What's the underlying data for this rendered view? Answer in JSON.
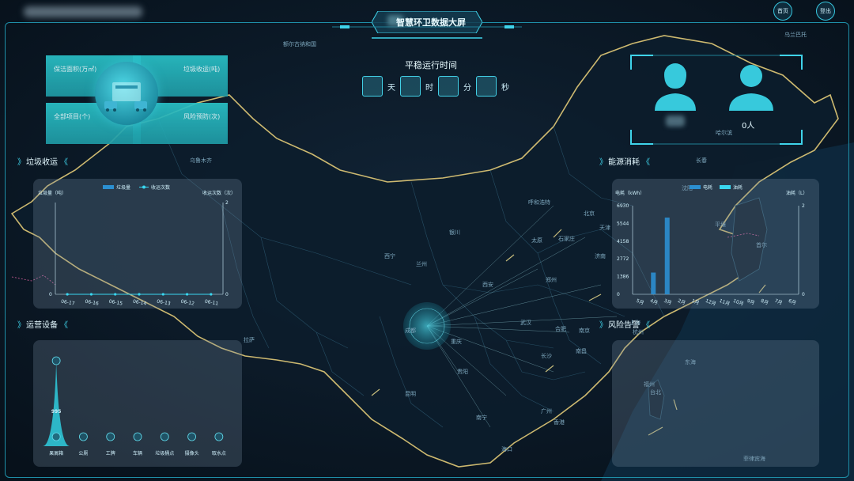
{
  "header": {
    "title": "智慧环卫数据大屏",
    "btn_home": "首页",
    "btn_logout": "登出"
  },
  "runtime": {
    "title": "平稳运行时间",
    "units": [
      "天",
      "时",
      "分",
      "秒"
    ]
  },
  "summary": {
    "clean_area_label": "保洁面积(万㎡)",
    "garbage_label": "垃圾收运(吨)",
    "projects_label": "全部项目(个)",
    "risk_label": "风险预防(次)"
  },
  "people": {
    "male_count": "0人"
  },
  "sections": {
    "garbage": "垃圾收运",
    "energy": "能源消耗",
    "equipment": "运营设备",
    "risk": "风险告警"
  },
  "map_labels": [
    "额尔古纳和国",
    "乌鲁木齐",
    "哈尔滨",
    "长春",
    "沈阳",
    "呼和浩特",
    "北京",
    "天津",
    "银川",
    "太原",
    "石家庄",
    "西宁",
    "兰州",
    "济南",
    "郑州",
    "西安",
    "拉萨",
    "成都",
    "重庆",
    "武汉",
    "合肥",
    "南京",
    "上海",
    "杭州",
    "长沙",
    "南昌",
    "福州",
    "贵阳",
    "昆明",
    "南宁",
    "广州",
    "香港",
    "台北",
    "海口",
    "东海",
    "菲律宾海",
    "首尔",
    "平壤",
    "乌兰巴托"
  ],
  "chart_data": [
    {
      "type": "bar",
      "title": "垃圾收运",
      "categories": [
        "06-17",
        "06-16",
        "06-15",
        "06-14",
        "06-13",
        "06-12",
        "06-11"
      ],
      "series": [
        {
          "name": "垃圾量",
          "values": [
            0,
            0,
            0,
            0,
            0,
            0,
            0
          ]
        },
        {
          "name": "收运次数",
          "values": [
            0,
            0,
            0,
            0,
            0,
            0,
            0
          ]
        }
      ],
      "ylabel_left": "垃圾量（吨）",
      "ylabel_right": "收运次数（次）",
      "ylim_left": [
        0,
        1
      ],
      "ylim_right": [
        0,
        2
      ],
      "y_ticks_left": [
        0
      ],
      "y_ticks_right": [
        0,
        2
      ],
      "legend_position": "top-left",
      "colors": {
        "bar": "#2b8fd1",
        "line": "#39d7f0"
      }
    },
    {
      "type": "bar",
      "title": "能源消耗",
      "categories": [
        "5月",
        "4月",
        "3月",
        "2月",
        "1月",
        "12月",
        "11月",
        "10月",
        "9月",
        "8月",
        "7月",
        "6月"
      ],
      "series": [
        {
          "name": "电耗",
          "values": [
            0,
            1700,
            6000,
            0,
            0,
            0,
            0,
            0,
            0,
            0,
            0,
            0
          ]
        },
        {
          "name": "油耗",
          "values": [
            0,
            0,
            0,
            0,
            0,
            0,
            0,
            0,
            0,
            0,
            0,
            0
          ]
        }
      ],
      "ylabel_left": "电耗（kWh）",
      "ylabel_right": "油耗（L）",
      "y_ticks_left": [
        0,
        1386,
        2772,
        4158,
        5544,
        6930
      ],
      "ylim_left": [
        0,
        6930
      ],
      "y_ticks_right": [
        0,
        2
      ],
      "ylim_right": [
        0,
        2
      ],
      "legend_position": "top-right",
      "colors": {
        "electricity": "#2b8fd1",
        "oil": "#39d7f0"
      }
    },
    {
      "type": "area",
      "title": "运营设备",
      "categories": [
        "果屑箱",
        "公厕",
        "工牌",
        "车辆",
        "垃圾桶点",
        "摄像头",
        "取水点"
      ],
      "values": [
        995,
        0,
        0,
        0,
        0,
        0,
        0
      ],
      "data_labels": [
        "995"
      ]
    }
  ],
  "colors": {
    "accent": "#39d7f0",
    "frame": "#1e8fa8",
    "background": "#08131f",
    "province_border": "#d8c274"
  }
}
